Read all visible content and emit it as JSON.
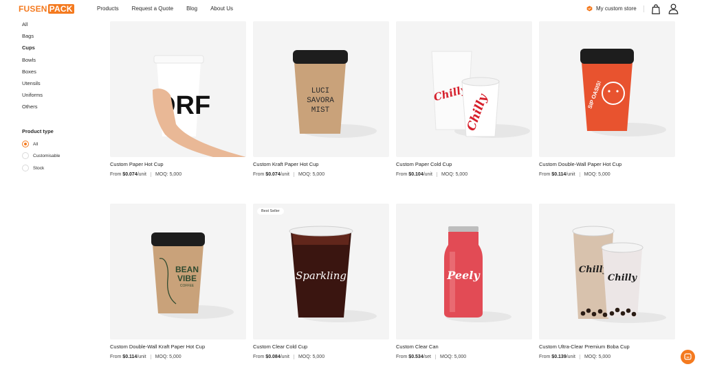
{
  "header": {
    "logo_part1": "FUSEN",
    "logo_part2": "PACK",
    "nav": [
      "Products",
      "Request a Quote",
      "Blog",
      "About Us"
    ],
    "store_label": "My custom store"
  },
  "sidebar": {
    "categories": [
      "All",
      "Bags",
      "Cups",
      "Bowls",
      "Boxes",
      "Utensils",
      "Uniforms",
      "Others"
    ],
    "active_category": "Cups",
    "product_type_title": "Product type",
    "product_types": [
      "All",
      "Customisable",
      "Stock"
    ],
    "selected_product_type": "All"
  },
  "products": [
    {
      "name": "Custom Paper Hot Cup",
      "price_prefix": "From ",
      "price": "$0.074",
      "unit": "/unit",
      "moq": "MOQ: 5,000",
      "badge": ""
    },
    {
      "name": "Custom Kraft Paper Hot Cup",
      "price_prefix": "From ",
      "price": "$0.074",
      "unit": "/unit",
      "moq": "MOQ: 5,000",
      "badge": ""
    },
    {
      "name": "Custom Paper Cold Cup",
      "price_prefix": "From ",
      "price": "$0.104",
      "unit": "/unit",
      "moq": "MOQ: 5,000",
      "badge": ""
    },
    {
      "name": "Custom Double-Wall Paper Hot Cup",
      "price_prefix": "From ",
      "price": "$0.114",
      "unit": "/unit",
      "moq": "MOQ: 5,000",
      "badge": ""
    },
    {
      "name": "Custom Double-Wall Kraft Paper Hot Cup",
      "price_prefix": "From ",
      "price": "$0.114",
      "unit": "/unit",
      "moq": "MOQ: 5,000",
      "badge": ""
    },
    {
      "name": "Custom Clear Cold Cup",
      "price_prefix": "From ",
      "price": "$0.084",
      "unit": "/unit",
      "moq": "MOQ: 5,000",
      "badge": "Best Seller"
    },
    {
      "name": "Custom Clear Can",
      "price_prefix": "From ",
      "price": "$0.534",
      "unit": "/set",
      "moq": "MOQ: 5,000",
      "badge": ""
    },
    {
      "name": "Custom Ultra-Clear Premium Boba Cup",
      "price_prefix": "From ",
      "price": "$0.139",
      "unit": "/unit",
      "moq": "MOQ: 5,000",
      "badge": ""
    }
  ],
  "image_labels": {
    "kraft_cup_text": [
      "LUCI",
      "SAVORA",
      "MIST"
    ],
    "paper_hot_cup_text": "ORF",
    "cold_cup_brand": "Chilly",
    "double_wall_text": "SIP OASIS!",
    "bean_vibe_text": [
      "BEAN",
      "VIBE",
      "COFFEE"
    ],
    "clear_cup_brand": "Sparkling",
    "can_brand": "Peely",
    "boba_brand": "Chilly"
  },
  "colors": {
    "accent": "#f47a1f",
    "card_bg": "#f4f4f4",
    "kraft": "#c9a27a",
    "double_wall_red": "#e8532f"
  },
  "icons": {
    "store": "store-icon",
    "bag": "shopping-bag-icon",
    "user": "user-icon",
    "chat": "chat-icon"
  }
}
